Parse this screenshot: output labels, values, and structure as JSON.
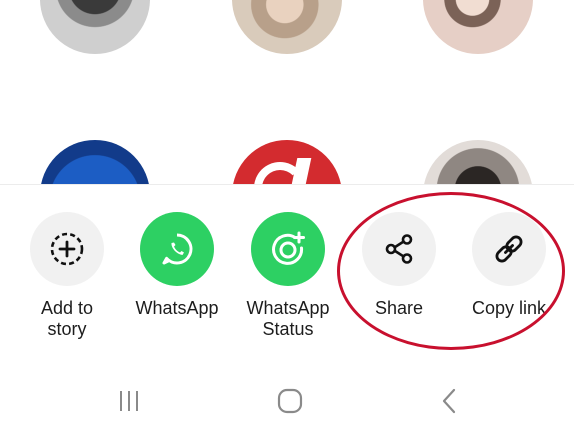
{
  "share_sheet": {
    "actions": [
      {
        "label": "Add to\nstory",
        "icon": "add-story-icon"
      },
      {
        "label": "WhatsApp",
        "icon": "whatsapp-icon"
      },
      {
        "label": "WhatsApp\nStatus",
        "icon": "whatsapp-status-icon"
      },
      {
        "label": "Share",
        "icon": "share-icon"
      },
      {
        "label": "Copy link",
        "icon": "link-icon"
      }
    ]
  },
  "navigation_bar": {
    "buttons": [
      "recent-apps-icon",
      "home-icon",
      "back-icon"
    ]
  },
  "colors": {
    "whatsapp_green": "#2dd063",
    "action_grey": "#f1f1f1",
    "annotation_red": "#c8102e"
  }
}
